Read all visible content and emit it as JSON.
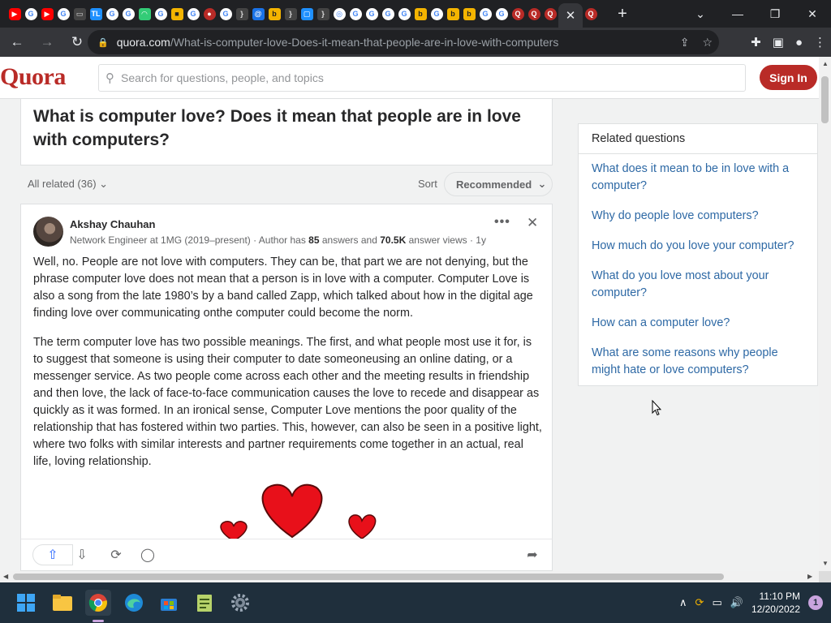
{
  "browser": {
    "active_tab_close": "✕",
    "new_tab": "+",
    "url_host": "quora.com",
    "url_path": "/What-is-computer-love-Does-it-mean-that-people-are-in-love-with-computers",
    "tab_favicons": [
      "youtube",
      "google",
      "youtube",
      "google",
      "monitor",
      "tl",
      "google",
      "google",
      "wifi",
      "google",
      "yellow-square",
      "google",
      "reddit",
      "google",
      "brackets",
      "at",
      "yellow",
      "brackets",
      "chat",
      "brackets",
      "chrome",
      "google",
      "google",
      "google",
      "google",
      "yellow",
      "google",
      "yellow",
      "yellow",
      "google",
      "google",
      "quora",
      "quora",
      "quora",
      "quora"
    ]
  },
  "quora": {
    "logo": "Quora",
    "search_placeholder": "Search for questions, people, and topics",
    "sign_in": "Sign In",
    "question_title": "What is computer love? Does it mean that people are in love with computers?",
    "all_related": "All related (36)",
    "sort_label": "Sort",
    "sort_value": "Recommended",
    "answer": {
      "author": "Akshay Chauhan",
      "cred_prefix": "Network Engineer at 1MG (2019–present) · Author has ",
      "answers_count": "85",
      "cred_middle": " answers and ",
      "views_count": "70.5K",
      "cred_suffix": " answer views · 1y",
      "para1": "Well, no. People are not love with computers. They can be, that part we are not denying, but the phrase computer love does not mean that a person is in love with a computer. Computer Love is also a song from the late 1980’s by a band called Zapp, which talked about how in the digital age finding love over communicating onthe computer could become the norm.",
      "para2": "The term computer love has two possible meanings. The first, and what people most use it for, is to suggest that someone is using their computer to date someoneusing an online dating, or a messenger service. As two people come across each other and the meeting results in friendship and then love, the lack of face-to-face communication causes the love to recede and disappear as quickly as it was formed. In an ironical sense, Computer Love mentions the poor quality of the relationship that has fostered within two parties. This, however, can also be seen in a positive light, where two folks with similar interests and partner requirements come together in an actual, real life, loving relationship."
    },
    "related": {
      "heading": "Related questions",
      "items": [
        "What does it mean to be in love with a computer?",
        "Why do people love computers?",
        "How much do you love your computer?",
        "What do you love most about your computer?",
        "How can a computer love?",
        "What are some reasons why people might hate or love computers?"
      ]
    }
  },
  "taskbar": {
    "time": "11:10 PM",
    "date": "12/20/2022",
    "notifications": "1"
  },
  "colors": {
    "quora_red": "#b92b27",
    "link_blue": "#2e69a5",
    "upvote_blue": "#2e69ff"
  }
}
